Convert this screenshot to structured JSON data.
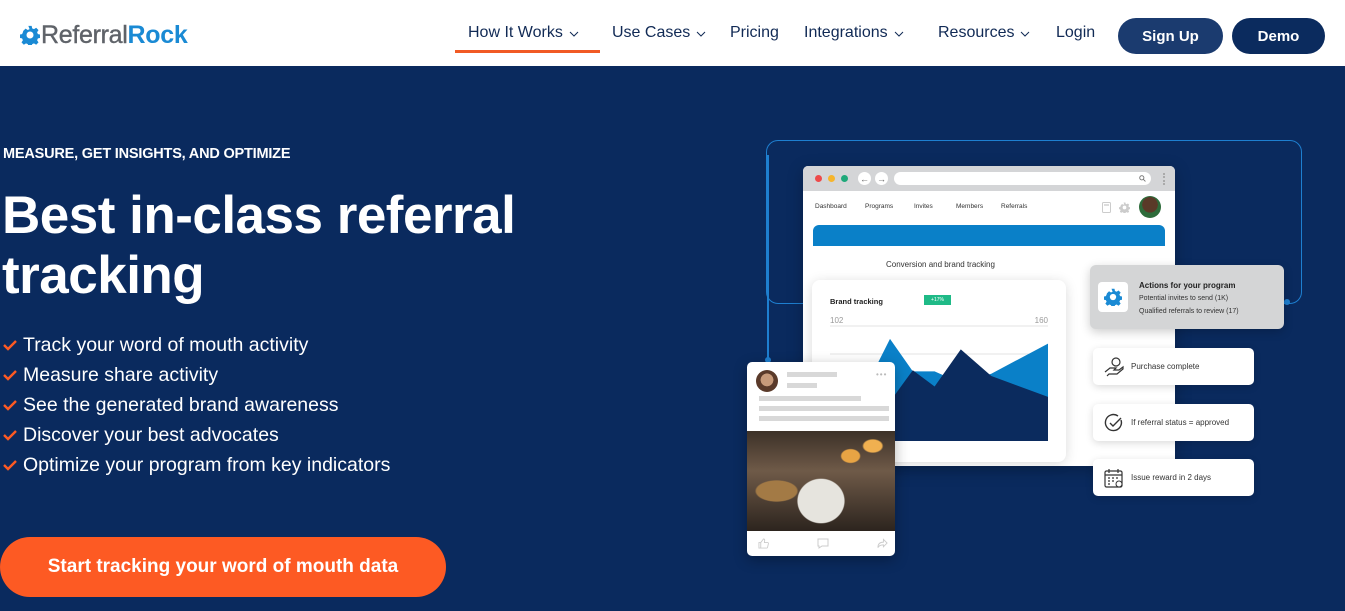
{
  "header": {
    "logo": {
      "part1": "Referral",
      "part2": "Rock",
      "icon": "gear-icon"
    },
    "nav": [
      {
        "label": "How It Works",
        "has_dropdown": true,
        "active": true
      },
      {
        "label": "Use Cases",
        "has_dropdown": true,
        "active": false
      },
      {
        "label": "Pricing",
        "has_dropdown": false,
        "active": false
      },
      {
        "label": "Integrations",
        "has_dropdown": true,
        "active": false
      },
      {
        "label": "Resources",
        "has_dropdown": true,
        "active": false
      },
      {
        "label": "Login",
        "has_dropdown": false,
        "active": false
      }
    ],
    "signup_label": "Sign Up",
    "demo_label": "Demo"
  },
  "hero": {
    "eyebrow": "MEASURE, GET INSIGHTS, AND OPTIMIZE",
    "headline_line1": "Best in-class referral",
    "headline_line2": "tracking",
    "bullets": [
      "Track your word of mouth activity",
      "Measure share activity",
      "See the generated brand awareness",
      "Discover your best advocates",
      "Optimize your program from key indicators"
    ],
    "cta_label": "Start tracking your word of mouth data"
  },
  "illustration": {
    "browser_nav": [
      "Dashboard",
      "Programs",
      "Invites",
      "Members",
      "Referrals"
    ],
    "section_title": "Conversion and brand tracking",
    "chart": {
      "title": "Brand tracking",
      "badge": "+17%",
      "y_left_label": "102",
      "y_right_label": "160"
    },
    "actions": {
      "title": "Actions for your program",
      "line1": "Potential invites to send (1K)",
      "line2": "Qualified referrals to review (17)"
    },
    "flow": [
      {
        "icon": "hand-coin-icon",
        "label": "Purchase complete"
      },
      {
        "icon": "check-circle-icon",
        "label": "If referral status = approved"
      },
      {
        "icon": "calendar-icon",
        "label": "Issue reward in 2 days"
      }
    ]
  },
  "colors": {
    "navy": "#0a2a5e",
    "orange": "#fd5a23",
    "brand_blue": "#1a8ad4",
    "chart_light": "#0a80c8",
    "chart_dark": "#0b2b5e",
    "badge_green": "#1fba87"
  },
  "chart_data": {
    "type": "area",
    "title": "Brand tracking",
    "annotations": [
      "+17%"
    ],
    "tick_labels": [
      "102",
      "160"
    ],
    "series": [
      {
        "name": "light",
        "values": [
          40,
          32,
          88,
          60,
          60,
          50,
          58,
          84
        ]
      },
      {
        "name": "dark",
        "values": [
          20,
          38,
          34,
          61,
          47,
          79,
          56,
          38
        ]
      }
    ]
  }
}
